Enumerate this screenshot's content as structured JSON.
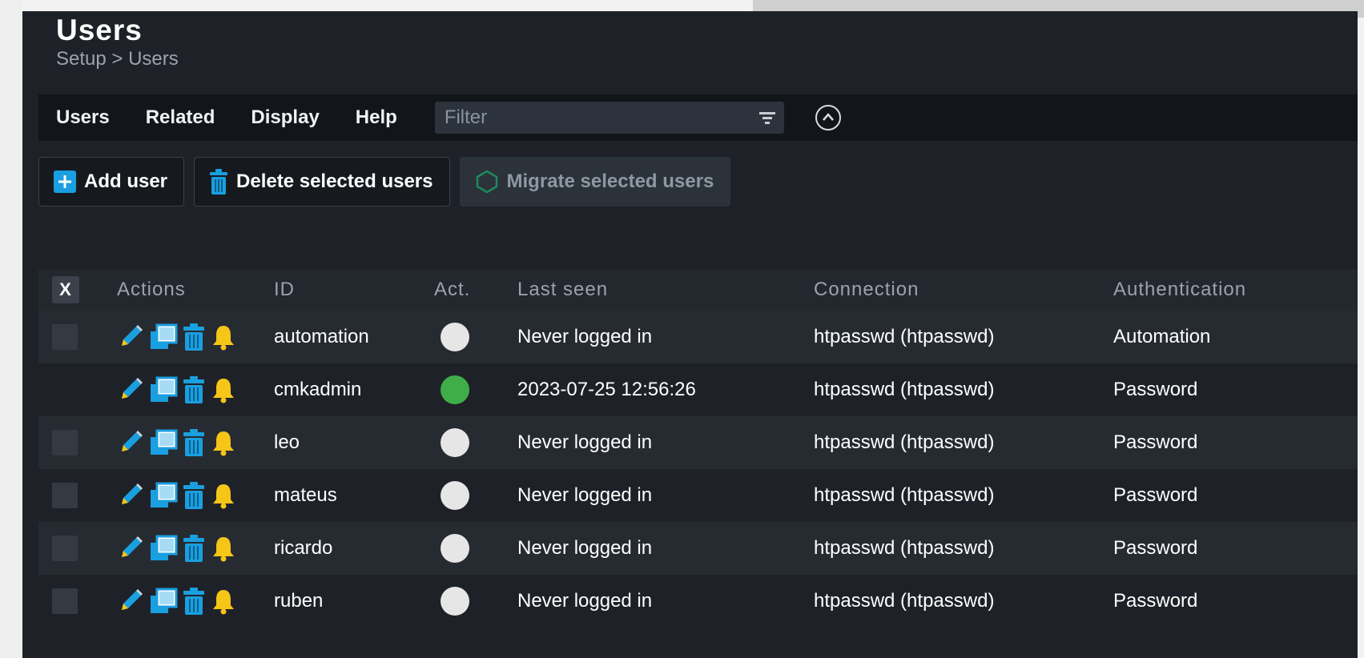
{
  "page": {
    "title": "Users",
    "breadcrumb": "Setup > Users"
  },
  "menu": {
    "items": [
      "Users",
      "Related",
      "Display",
      "Help"
    ],
    "filter_placeholder": "Filter"
  },
  "toolbar": {
    "add_user": "Add user",
    "delete_selected": "Delete selected users",
    "migrate_selected": "Migrate selected users"
  },
  "table": {
    "select_all_label": "X",
    "columns": [
      "Actions",
      "ID",
      "Act.",
      "Last seen",
      "Connection",
      "Authentication"
    ],
    "rows": [
      {
        "id": "automation",
        "active": false,
        "last_seen": "Never logged in",
        "connection": "htpasswd (htpasswd)",
        "authentication": "Automation",
        "selectable": true
      },
      {
        "id": "cmkadmin",
        "active": true,
        "last_seen": "2023-07-25 12:56:26",
        "connection": "htpasswd (htpasswd)",
        "authentication": "Password",
        "selectable": false
      },
      {
        "id": "leo",
        "active": false,
        "last_seen": "Never logged in",
        "connection": "htpasswd (htpasswd)",
        "authentication": "Password",
        "selectable": true
      },
      {
        "id": "mateus",
        "active": false,
        "last_seen": "Never logged in",
        "connection": "htpasswd (htpasswd)",
        "authentication": "Password",
        "selectable": true
      },
      {
        "id": "ricardo",
        "active": false,
        "last_seen": "Never logged in",
        "connection": "htpasswd (htpasswd)",
        "authentication": "Password",
        "selectable": true
      },
      {
        "id": "ruben",
        "active": false,
        "last_seen": "Never logged in",
        "connection": "htpasswd (htpasswd)",
        "authentication": "Password",
        "selectable": true
      }
    ]
  },
  "colors": {
    "active": "#3fae49",
    "inactive": "#e6e6e6",
    "icon_blue": "#1a9fe0",
    "bell": "#f5c518",
    "add_icon": "#1a9fe0",
    "migrate_icon": "#1f8a5b"
  },
  "icons": {
    "row_actions": [
      "pencil-icon",
      "clone-icon",
      "trash-icon",
      "bell-icon"
    ]
  }
}
